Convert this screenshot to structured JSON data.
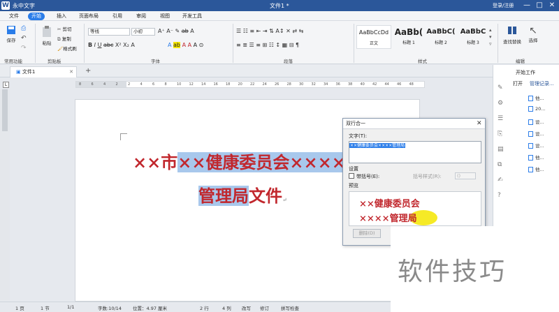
{
  "window": {
    "app_title": "永中文字",
    "doc_title": "文件1 *",
    "login": "登录/注册",
    "minimize": "—",
    "maximize": "□",
    "close": "✕"
  },
  "menu": [
    "文件",
    "开始",
    "插入",
    "页面布局",
    "引用",
    "审阅",
    "视图",
    "开发工具"
  ],
  "ribbon": {
    "groups": [
      "常用功能",
      "剪贴板",
      "字体",
      "段落",
      "样式",
      "编辑"
    ],
    "save": "保存",
    "paste": "粘贴",
    "cut": "剪切",
    "copy": "复制",
    "format_painter": "格式刷",
    "font_name": "等线",
    "font_size": "小初",
    "styles": [
      {
        "preview": "AaBbCcDd",
        "name": "正文"
      },
      {
        "preview": "AaBb(",
        "name": "标题 1"
      },
      {
        "preview": "AaBbC(",
        "name": "标题 2"
      },
      {
        "preview": "AaBbC",
        "name": "标题 3"
      }
    ],
    "find_replace": "查找替换",
    "select": "选择"
  },
  "tabs": {
    "doc_tab": "文件1",
    "add": "+"
  },
  "ruler": [
    "8",
    "6",
    "4",
    "2",
    "2",
    "4",
    "6",
    "8",
    "10",
    "12",
    "14",
    "16",
    "18",
    "20",
    "22",
    "24",
    "26",
    "28",
    "30",
    "32",
    "34",
    "36",
    "38",
    "40",
    "42",
    "44",
    "46",
    "48"
  ],
  "document": {
    "line1_a": "××市",
    "line1_b": "××健康委员会××××",
    "line2_a": "管理局",
    "line2_b": "文件"
  },
  "dialog": {
    "title": "双行合一",
    "text_label": "文字(T):",
    "text_value": "××健康委员会××××管理局",
    "settings_label": "设置",
    "bracket_label": "带括号(E):",
    "bracket_style_label": "括号样式(R):",
    "bracket_style_value": "()",
    "preview_label": "预览",
    "preview_line1": "××健康委员会",
    "preview_line2": "××××管理局",
    "delete_button": "删除(D)"
  },
  "right_panel": {
    "title": "开始工作",
    "open": "打开",
    "recent": "管理记录...",
    "files": [
      "他...",
      "20...",
      "设...",
      "设...",
      "设...",
      "他...",
      "他..."
    ]
  },
  "status": {
    "page": "1 页",
    "section": "1 节",
    "pages": "1/1",
    "words": "字数:10/14",
    "position": "位置：4.97 厘米",
    "row": "2 行",
    "col": "4 列",
    "revise": "改写",
    "track": "修订",
    "spell": "拼写检查"
  },
  "watermark": "软件技巧",
  "colors": {
    "accent": "#2b7de9",
    "title_bg": "#2b579a",
    "red_text": "#c1272d",
    "highlight": "#a8c8ec",
    "preview_yellow": "#f5e600"
  }
}
